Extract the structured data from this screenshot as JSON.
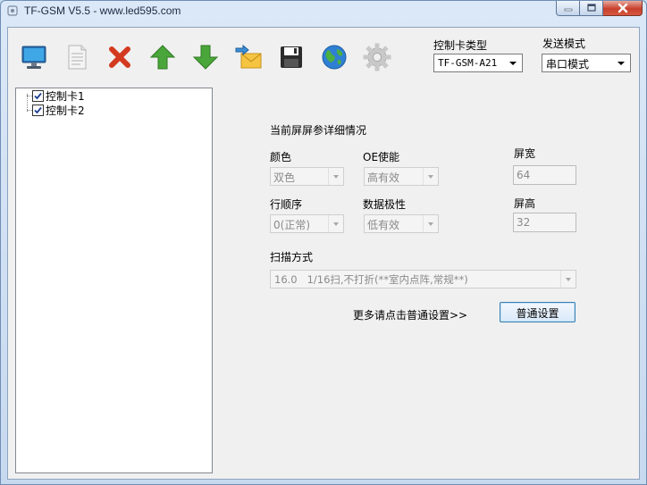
{
  "window": {
    "title": "TF-GSM V5.5 - www.led595.com"
  },
  "toolbar": {
    "buttons": [
      {
        "name": "monitor-icon"
      },
      {
        "name": "document-icon"
      },
      {
        "name": "delete-icon"
      },
      {
        "name": "arrow-up-icon"
      },
      {
        "name": "arrow-down-icon"
      },
      {
        "name": "send-mail-icon"
      },
      {
        "name": "save-icon"
      },
      {
        "name": "globe-icon"
      },
      {
        "name": "gear-icon"
      }
    ]
  },
  "header": {
    "card_type_label": "控制卡类型",
    "card_type_value": "TF-GSM-A21",
    "send_mode_label": "发送模式",
    "send_mode_value": "串口模式"
  },
  "tree": {
    "items": [
      {
        "label": "控制卡1",
        "checked": true
      },
      {
        "label": "控制卡2",
        "checked": true
      }
    ]
  },
  "details": {
    "heading": "当前屏屏参详细情况",
    "color_label": "颜色",
    "color_value": "双色",
    "oe_label": "OE使能",
    "oe_value": "高有效",
    "width_label": "屏宽",
    "width_value": "64",
    "row_order_label": "行顺序",
    "row_order_value": "0(正常)",
    "data_polarity_label": "数据极性",
    "data_polarity_value": "低有效",
    "height_label": "屏高",
    "height_value": "32",
    "scan_label": "扫描方式",
    "scan_value": "16.0   1/16扫,不打折(**室内点阵,常规**)",
    "more_text": "更多请点击普通设置>>",
    "settings_button": "普通设置"
  },
  "colors": {
    "title_bar": "#c7d9ef",
    "client_bg": "#f0f0f0",
    "close_button": "#c7402d",
    "accent_button_border": "#3c7fb1"
  }
}
